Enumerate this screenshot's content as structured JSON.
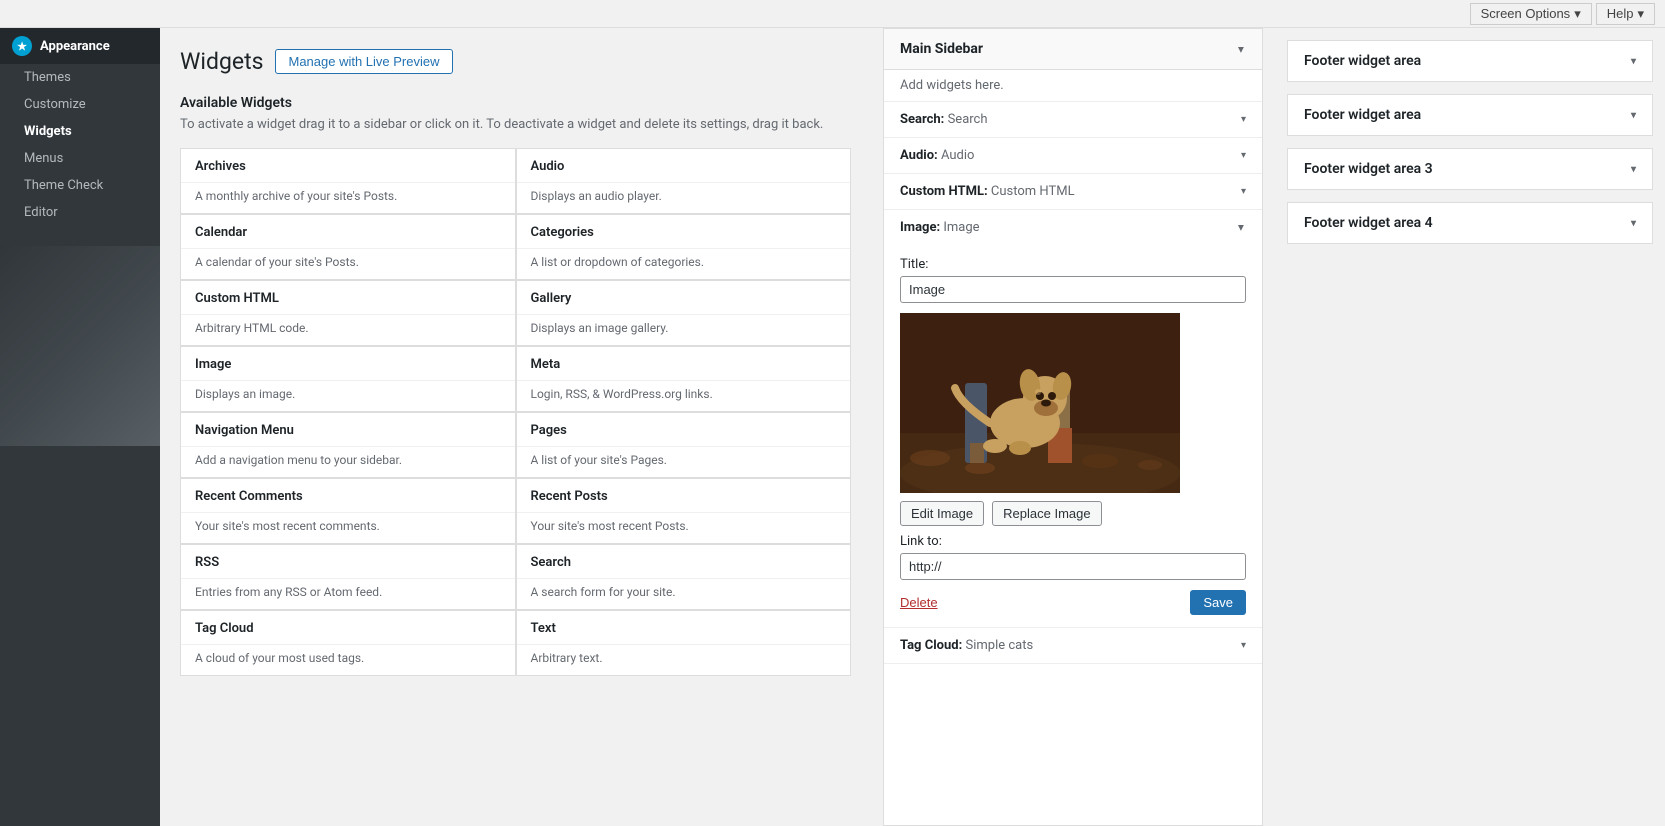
{
  "topbar": {
    "screen_options": "Screen Options",
    "help": "Help"
  },
  "sidebar": {
    "brand": "Appearance",
    "items": [
      {
        "label": "Themes",
        "id": "themes"
      },
      {
        "label": "Customize",
        "id": "customize"
      },
      {
        "label": "Widgets",
        "id": "widgets",
        "active": true
      },
      {
        "label": "Menus",
        "id": "menus"
      },
      {
        "label": "Theme Check",
        "id": "theme-check"
      },
      {
        "label": "Editor",
        "id": "editor"
      }
    ]
  },
  "page": {
    "title": "Widgets",
    "live_preview_btn": "Manage with Live Preview"
  },
  "available_widgets": {
    "title": "Available Widgets",
    "description": "To activate a widget drag it to a sidebar or click on it. To deactivate a widget and delete its settings, drag it back.",
    "widgets": [
      {
        "name": "Archives",
        "desc": "A monthly archive of your site's Posts."
      },
      {
        "name": "Audio",
        "desc": "Displays an audio player."
      },
      {
        "name": "Calendar",
        "desc": "A calendar of your site's Posts."
      },
      {
        "name": "Categories",
        "desc": "A list or dropdown of categories."
      },
      {
        "name": "Custom HTML",
        "desc": "Arbitrary HTML code."
      },
      {
        "name": "Gallery",
        "desc": "Displays an image gallery."
      },
      {
        "name": "Image",
        "desc": "Displays an image."
      },
      {
        "name": "Meta",
        "desc": "Login, RSS, & WordPress.org links."
      },
      {
        "name": "Navigation Menu",
        "desc": "Add a navigation menu to your sidebar."
      },
      {
        "name": "Pages",
        "desc": "A list of your site's Pages."
      },
      {
        "name": "Recent Comments",
        "desc": "Your site's most recent comments."
      },
      {
        "name": "Recent Posts",
        "desc": "Your site's most recent Posts."
      },
      {
        "name": "RSS",
        "desc": "Entries from any RSS or Atom feed."
      },
      {
        "name": "Search",
        "desc": "A search form for your site."
      },
      {
        "name": "Tag Cloud",
        "desc": "A cloud of your most used tags."
      },
      {
        "name": "Text",
        "desc": "Arbitrary text."
      }
    ]
  },
  "main_sidebar": {
    "title": "Main Sidebar",
    "add_widgets_hint": "Add widgets here.",
    "widgets": [
      {
        "label": "Search",
        "name": "Search",
        "expanded": false
      },
      {
        "label": "Audio",
        "name": "Audio",
        "expanded": false
      },
      {
        "label": "Custom HTML",
        "name": "Custom HTML",
        "expanded": false
      },
      {
        "label": "Image",
        "name": "Image",
        "expanded": true
      },
      {
        "label": "Tag Cloud",
        "name": "Simple cats",
        "expanded": false
      }
    ],
    "image_widget": {
      "title_label": "Title:",
      "title_value": "Image",
      "link_label": "Link to:",
      "link_value": "http://",
      "edit_btn": "Edit Image",
      "replace_btn": "Replace Image",
      "delete_btn": "Delete",
      "save_btn": "Save"
    }
  },
  "footer_areas": [
    {
      "label": "Footer widget area",
      "id": "footer-1",
      "subtitle": ""
    },
    {
      "label": "Footer widget area",
      "id": "footer-2",
      "subtitle": ""
    },
    {
      "label": "Footer widget area 3",
      "id": "footer-3"
    },
    {
      "label": "Footer widget area 4",
      "id": "footer-4"
    }
  ]
}
